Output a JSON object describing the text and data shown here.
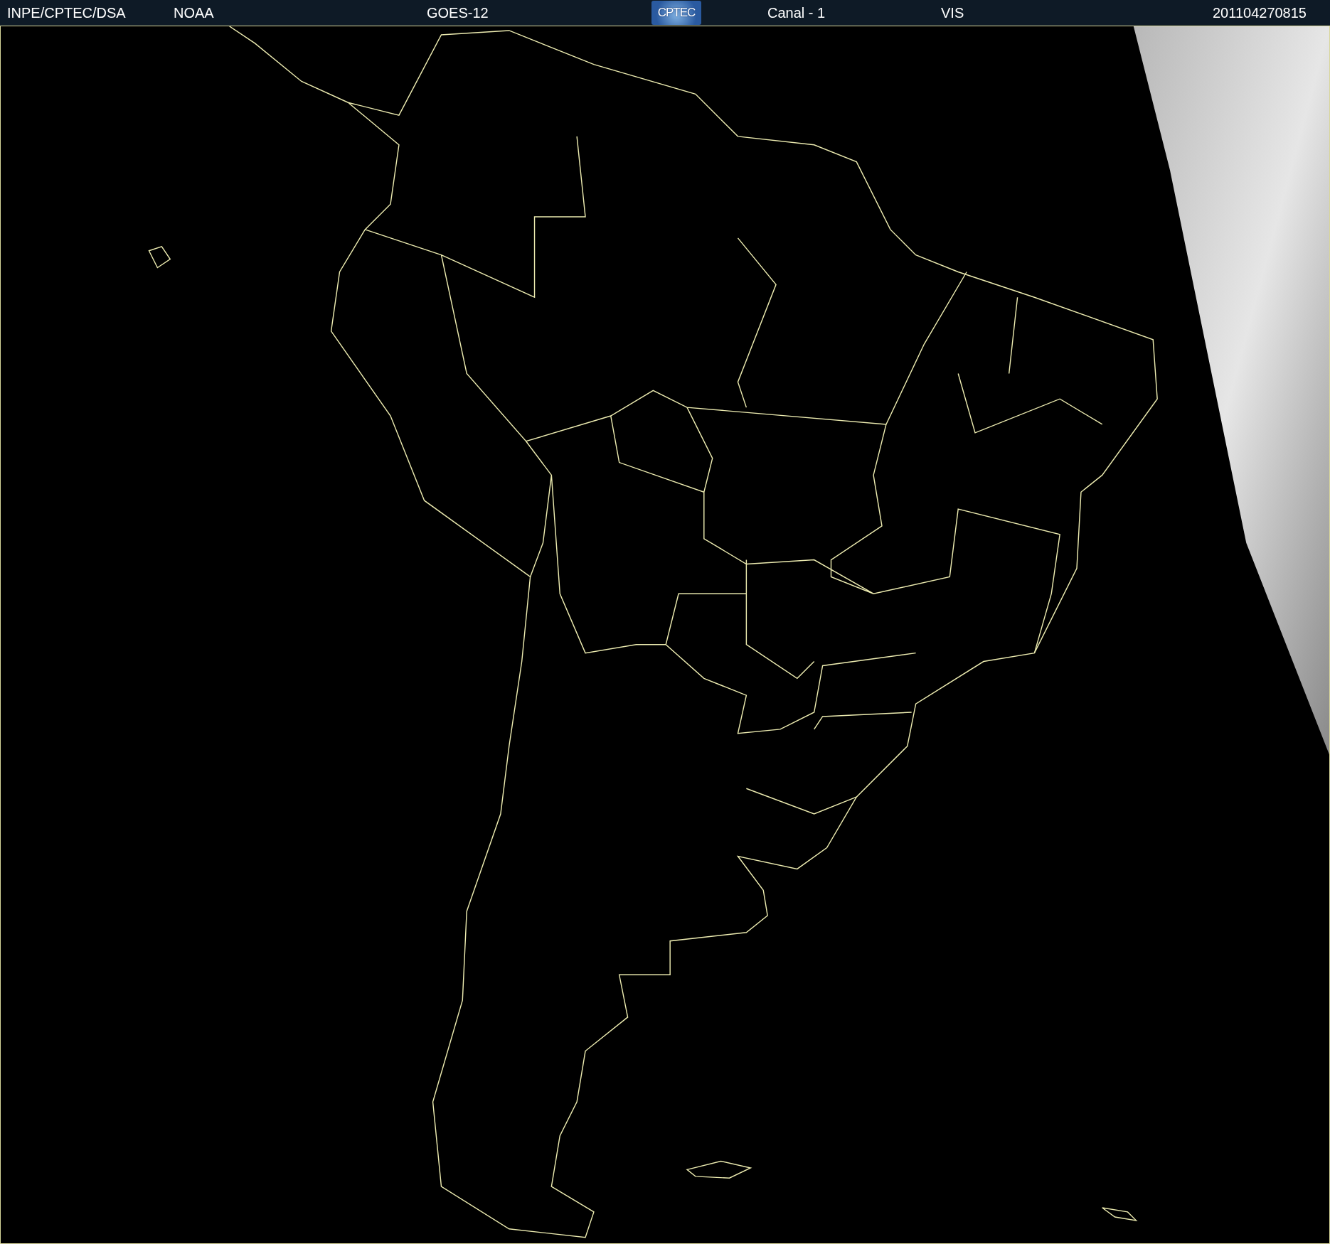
{
  "header": {
    "agency": "INPE/CPTEC/DSA",
    "source": "NOAA",
    "satellite": "GOES-12",
    "logo_text": "CPTEC",
    "channel": "Canal - 1",
    "band": "VIS",
    "timestamp": "201104270815"
  }
}
